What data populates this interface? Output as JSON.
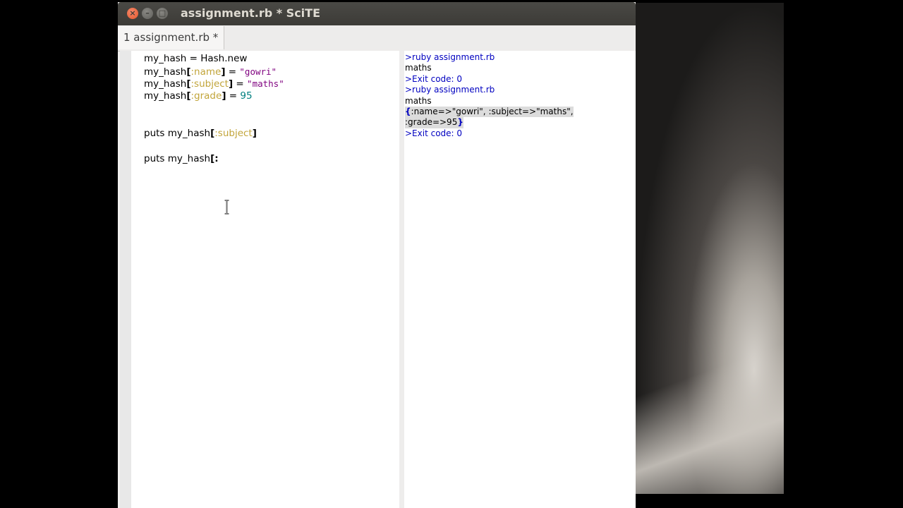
{
  "window": {
    "title": "assignment.rb * SciTE",
    "close_glyph": "×",
    "minimize_glyph": "–",
    "maximize_glyph": "□"
  },
  "tabs": [
    {
      "label": "1 assignment.rb *",
      "active": true
    }
  ],
  "editor": {
    "lines": [
      {
        "a": "my_hash = Hash.new"
      },
      {
        "a": "my_hash",
        "b": "[",
        "c": ":name",
        "d": "]",
        "e": " = ",
        "f": "\"gowri\""
      },
      {
        "a": "my_hash",
        "b": "[",
        "c": ":subject",
        "d": "]",
        "e": " = ",
        "f": "\"maths\""
      },
      {
        "a": "my_hash",
        "b": "[",
        "c": ":grade",
        "d": "]",
        "e": " = ",
        "n": "95"
      },
      {
        "a": ""
      },
      {
        "a": ""
      },
      {
        "a": "puts my_hash",
        "b": "[",
        "c": ":subject",
        "d": "]"
      },
      {
        "a": ""
      },
      {
        "a": "puts my_hash",
        "b": "[",
        "c": ":"
      }
    ]
  },
  "output": {
    "lines": [
      {
        "kind": "cmd",
        "text": ">ruby assignment.rb"
      },
      {
        "kind": "plain",
        "text": "maths"
      },
      {
        "kind": "cmd",
        "text": ">Exit code: 0"
      },
      {
        "kind": "cmd",
        "text": ">ruby assignment.rb"
      },
      {
        "kind": "plain",
        "text": "maths"
      },
      {
        "kind": "hash1_open",
        "brace": "{",
        "text": ":name=>\"gowri\", :subject=>\"maths\","
      },
      {
        "kind": "hash2_close",
        "text": ":grade=>95",
        "brace": "}"
      },
      {
        "kind": "cmd",
        "text": ">Exit code: 0"
      }
    ]
  },
  "colors": {
    "titlebar": "#3c3b37",
    "close_button": "#e2582d",
    "symbol": "#c2a53a",
    "string": "#7f007f",
    "number": "#007f7f",
    "output_command": "#0000c0"
  },
  "cursor": {
    "icon": "i-beam-cursor-icon"
  }
}
